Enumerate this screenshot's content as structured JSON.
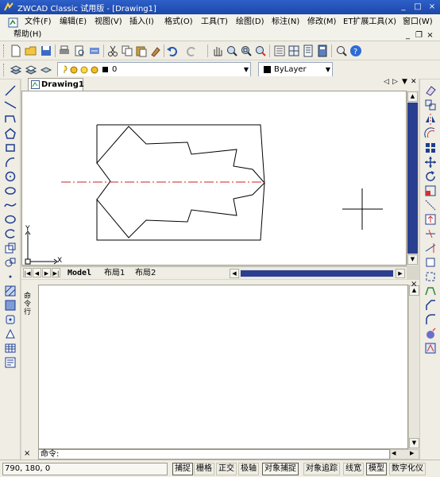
{
  "window": {
    "title": "ZWCAD Classic 试用版 - [Drawing1]"
  },
  "menu": {
    "row1": [
      "文件(F)",
      "编辑(E)",
      "视图(V)",
      "插入(I)",
      "格式(O)",
      "工具(T)",
      "绘图(D)",
      "标注(N)",
      "修改(M)",
      "ET扩展工具(X)",
      "窗口(W)"
    ],
    "row2": [
      "帮助(H)"
    ]
  },
  "window_controls": {
    "minimize": "_",
    "maximize": "□",
    "close": "×"
  },
  "mdi_controls": {
    "minimize": "_",
    "restore": "❐",
    "close": "×"
  },
  "properties_toolbar": {
    "layer_value": "0",
    "color_value": "ByLayer"
  },
  "document": {
    "tab_label": "Drawing1",
    "ucs_x_label": "X",
    "ucs_y_label": "Y"
  },
  "layout_tabs": [
    "Model",
    "布局1",
    "布局2"
  ],
  "command": {
    "side_label": "命令行",
    "prompt": "命令:",
    "close": "×"
  },
  "status": {
    "coords": "790, 180, 0",
    "buttons": [
      {
        "label": "捕捉",
        "on": true
      },
      {
        "label": "栅格",
        "on": false
      },
      {
        "label": "正交",
        "on": false
      },
      {
        "label": "极轴",
        "on": false
      },
      {
        "label": "对象捕捉",
        "on": true
      },
      {
        "label": "对象追踪",
        "on": false
      },
      {
        "label": "线宽",
        "on": false
      },
      {
        "label": "模型",
        "on": true
      },
      {
        "label": "数字化仪",
        "on": false
      }
    ]
  },
  "colors": {
    "titlebar": "#1b47a8",
    "centerline": "#d12020",
    "scroll_thumb": "#2a3f8f"
  }
}
